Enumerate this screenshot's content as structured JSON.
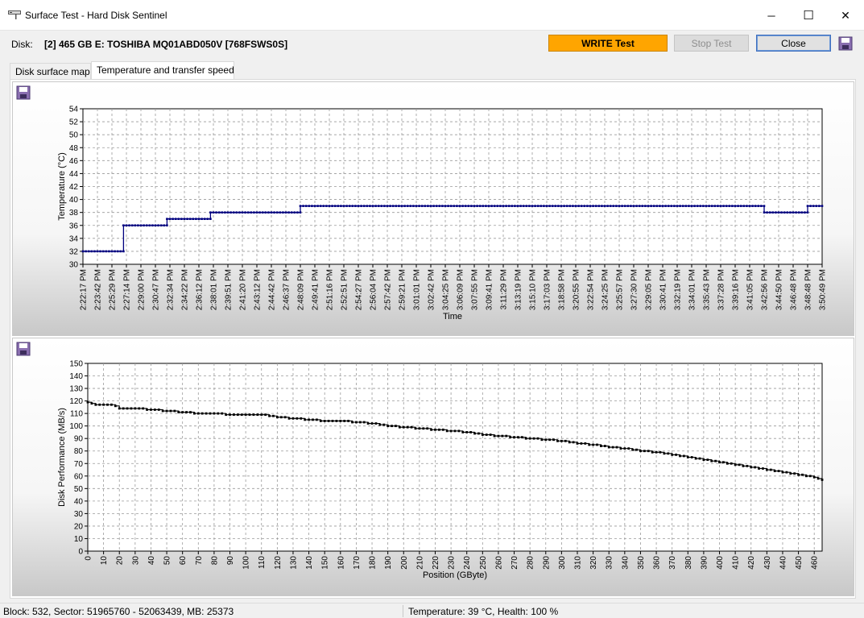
{
  "window": {
    "title": "Surface Test - Hard Disk Sentinel",
    "minimize_glyph": "─",
    "maximize_glyph": "☐",
    "close_glyph": "✕"
  },
  "disk": {
    "label": "Disk:",
    "name": "[2] 465 GB E: TOSHIBA MQ01ABD050V [768FSWS0S]"
  },
  "toolbar": {
    "write_test_label": "WRITE Test",
    "stop_test_label": "Stop Test",
    "close_label": "Close"
  },
  "tabs": [
    {
      "label": "Disk surface map",
      "active": false
    },
    {
      "label": "Temperature and transfer speed",
      "active": true
    }
  ],
  "status": {
    "left": "Block: 532, Sector: 51965760 - 52063439, MB: 25373",
    "right": "Temperature: 39  °C,  Health: 100 %"
  },
  "colors": {
    "accent_write": "#ffa500",
    "temperature_line": "#00007f",
    "performance_line": "#000000"
  },
  "chart_data": [
    {
      "type": "line",
      "title": "",
      "xlabel": "Time",
      "ylabel": "Temperature (°C)",
      "ylim": [
        30,
        54
      ],
      "y_ticks": [
        30,
        32,
        34,
        36,
        38,
        40,
        42,
        44,
        46,
        48,
        50,
        52,
        54
      ],
      "grid": true,
      "x_ticks": [
        "2:22:17 PM",
        "2:23:42 PM",
        "2:25:29 PM",
        "2:27:14 PM",
        "2:29:00 PM",
        "2:30:47 PM",
        "2:32:34 PM",
        "2:34:22 PM",
        "2:36:12 PM",
        "2:38:01 PM",
        "2:39:51 PM",
        "2:41:20 PM",
        "2:43:12 PM",
        "2:44:42 PM",
        "2:46:37 PM",
        "2:48:09 PM",
        "2:49:41 PM",
        "2:51:16 PM",
        "2:52:51 PM",
        "2:54:27 PM",
        "2:56:04 PM",
        "2:57:42 PM",
        "2:59:21 PM",
        "3:01:01 PM",
        "3:02:42 PM",
        "3:04:25 PM",
        "3:06:09 PM",
        "3:07:55 PM",
        "3:09:41 PM",
        "3:11:29 PM",
        "3:13:19 PM",
        "3:15:10 PM",
        "3:17:03 PM",
        "3:18:58 PM",
        "3:20:55 PM",
        "3:22:54 PM",
        "3:24:25 PM",
        "3:25:57 PM",
        "3:27:30 PM",
        "3:29:05 PM",
        "3:30:41 PM",
        "3:32:19 PM",
        "3:34:01 PM",
        "3:35:43 PM",
        "3:37:28 PM",
        "3:39:16 PM",
        "3:41:05 PM",
        "3:42:56 PM",
        "3:44:50 PM",
        "3:46:48 PM",
        "3:48:48 PM",
        "3:50:49 PM"
      ],
      "segments": [
        {
          "from": 0,
          "to": 2.8,
          "value": 32
        },
        {
          "from": 2.8,
          "to": 5.8,
          "value": 36
        },
        {
          "from": 5.8,
          "to": 8.8,
          "value": 37
        },
        {
          "from": 8.8,
          "to": 15.0,
          "value": 38
        },
        {
          "from": 15.0,
          "to": 47.0,
          "value": 39
        },
        {
          "from": 47.0,
          "to": 50.0,
          "value": 38
        },
        {
          "from": 50.0,
          "to": 51.0,
          "value": 39
        }
      ]
    },
    {
      "type": "line",
      "title": "",
      "xlabel": "Position (GByte)",
      "ylabel": "Disk Performance (MB/s)",
      "ylim": [
        0,
        150
      ],
      "xlim": [
        0,
        465
      ],
      "y_ticks": [
        0,
        10,
        20,
        30,
        40,
        50,
        60,
        70,
        80,
        90,
        100,
        110,
        120,
        130,
        140,
        150
      ],
      "x_ticks": [
        0,
        10,
        20,
        30,
        40,
        50,
        60,
        70,
        80,
        90,
        100,
        110,
        120,
        130,
        140,
        150,
        160,
        170,
        180,
        190,
        200,
        210,
        220,
        230,
        240,
        250,
        260,
        270,
        280,
        290,
        300,
        310,
        320,
        330,
        340,
        350,
        360,
        370,
        380,
        390,
        400,
        410,
        420,
        430,
        440,
        450,
        460
      ],
      "grid": true,
      "x": [
        0,
        2,
        5,
        10,
        15,
        20,
        30,
        40,
        50,
        60,
        70,
        80,
        90,
        100,
        110,
        120,
        130,
        140,
        150,
        160,
        170,
        180,
        190,
        200,
        210,
        220,
        230,
        240,
        250,
        260,
        270,
        280,
        290,
        300,
        310,
        320,
        330,
        340,
        350,
        360,
        370,
        380,
        390,
        400,
        410,
        420,
        430,
        440,
        450,
        460,
        465
      ],
      "values": [
        119,
        118,
        117,
        117,
        117,
        114,
        114,
        113,
        112,
        111,
        110,
        110,
        109,
        109,
        109,
        107,
        106,
        105,
        104,
        104,
        103,
        102,
        100,
        99,
        98,
        97,
        96,
        95,
        93,
        92,
        91,
        90,
        89,
        88,
        86,
        85,
        83,
        82,
        80,
        79,
        77,
        75,
        73,
        71,
        69,
        67,
        65,
        63,
        61,
        59,
        57
      ]
    }
  ]
}
